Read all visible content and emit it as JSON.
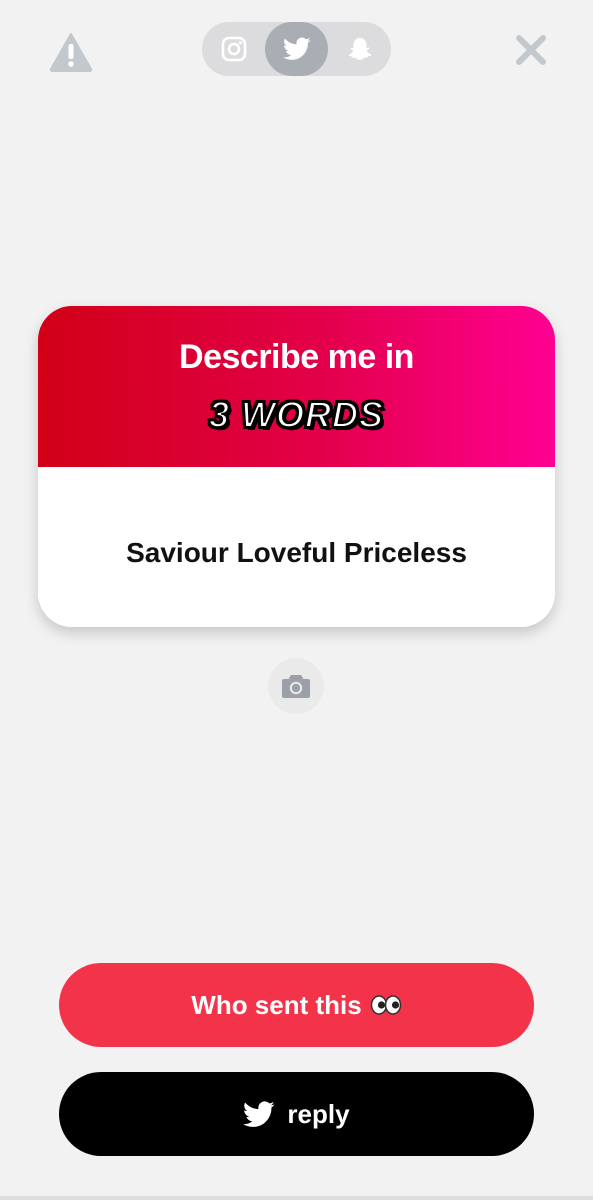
{
  "top_bar": {
    "report_icon": "warning-triangle-icon",
    "close_icon": "close-x-icon",
    "platforms": [
      {
        "name": "instagram",
        "icon": "instagram-icon",
        "active": false
      },
      {
        "name": "twitter",
        "icon": "twitter-bird-icon",
        "active": true
      },
      {
        "name": "snapchat",
        "icon": "snapchat-ghost-icon",
        "active": false
      }
    ]
  },
  "card": {
    "title": "Describe me in",
    "badge": "3 WORDS",
    "answer": "Saviour Loveful Priceless",
    "gradient_colors": [
      "#d10016",
      "#ff0092"
    ]
  },
  "camera": {
    "icon": "camera-icon"
  },
  "actions": {
    "who_sent_label": "Who sent this",
    "who_sent_emoji": "👀",
    "reply_label": "reply",
    "reply_icon": "twitter-bird-icon"
  },
  "colors": {
    "background": "#f2f2f2",
    "accent_red": "#f2334a",
    "reply_black": "#000000",
    "icon_gray": "#c2c6ca"
  }
}
